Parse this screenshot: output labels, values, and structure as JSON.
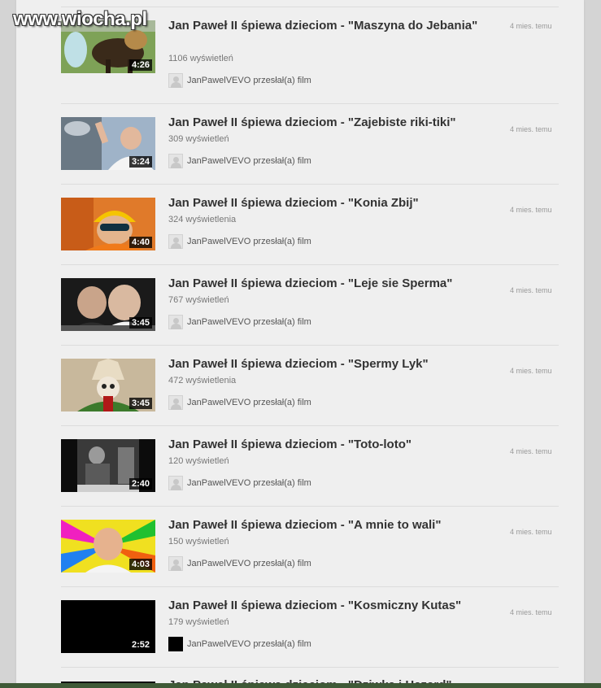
{
  "watermark": "www.wiocha.pl",
  "uploader_text": "JanPawelVEVO przesłał(a) film",
  "videos": [
    {
      "title": "Jan Paweł II śpiewa dzieciom - \"Maszyna do Jebania\"",
      "views": "1106 wyświetleń",
      "duration": "4:26",
      "time": "4 mies. temu"
    },
    {
      "title": "Jan Paweł II śpiewa dzieciom - \"Zajebiste riki-tiki\"",
      "views": "309 wyświetleń",
      "duration": "3:24",
      "time": "4 mies. temu"
    },
    {
      "title": "Jan Paweł II śpiewa dzieciom - \"Konia Zbij\"",
      "views": "324 wyświetlenia",
      "duration": "4:40",
      "time": "4 mies. temu"
    },
    {
      "title": "Jan Paweł II śpiewa dzieciom - \"Leje sie Sperma\"",
      "views": "767 wyświetleń",
      "duration": "3:45",
      "time": "4 mies. temu"
    },
    {
      "title": "Jan Paweł II śpiewa dzieciom - \"Spermy Lyk\"",
      "views": "472 wyświetlenia",
      "duration": "3:45",
      "time": "4 mies. temu"
    },
    {
      "title": "Jan Paweł II śpiewa dzieciom - \"Toto-loto\"",
      "views": "120 wyświetleń",
      "duration": "2:40",
      "time": "4 mies. temu"
    },
    {
      "title": "Jan Paweł II śpiewa dzieciom - \"A mnie to wali\"",
      "views": "150 wyświetleń",
      "duration": "4:03",
      "time": "4 mies. temu"
    },
    {
      "title": "Jan Paweł II śpiewa dzieciom - \"Kosmiczny Kutas\"",
      "views": "179 wyświetleń",
      "duration": "2:52",
      "time": "4 mies. temu"
    }
  ],
  "partial_title": "Jan Paweł II śpiewa dzieciom - \"Dziwka i Hazard\""
}
